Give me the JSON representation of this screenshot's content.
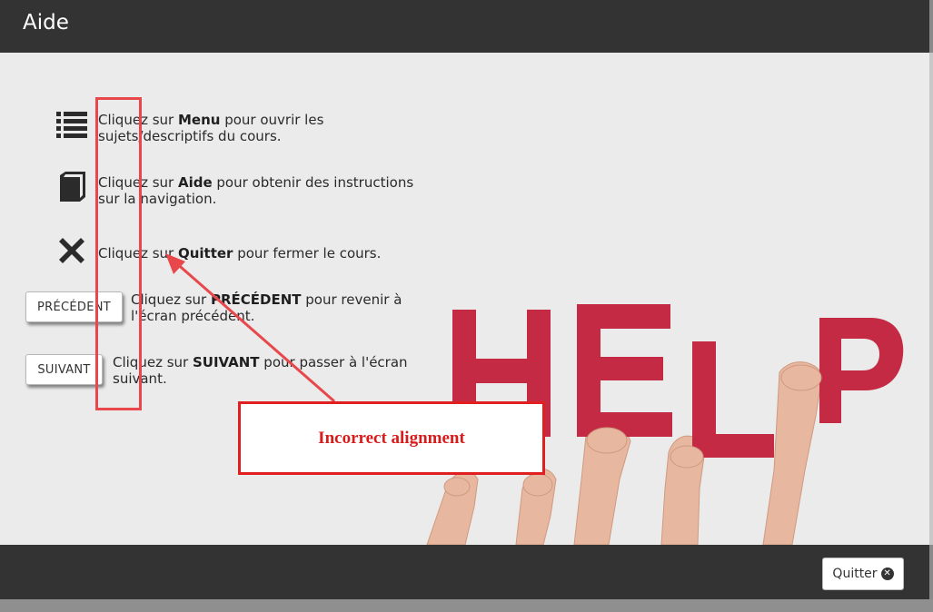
{
  "header": {
    "title": "Aide"
  },
  "help_items": [
    {
      "prefix": "Cliquez sur ",
      "keyword": "Menu",
      "suffix": " pour ouvrir les sujets/descriptifs du cours.",
      "icon": "list-icon"
    },
    {
      "prefix": "Cliquez sur ",
      "keyword": "Aide",
      "suffix": " pour obtenir des instructions sur la navigation.",
      "icon": "book-icon"
    },
    {
      "prefix": "Cliquez sur ",
      "keyword": "Quitter",
      "suffix": " pour fermer le cours.",
      "icon": "close-icon"
    },
    {
      "button_label": "PRÉCÉDENT",
      "prefix": "Cliquez sur ",
      "keyword": "PRÉCÉDENT",
      "suffix": " pour revenir à l'écran précédent."
    },
    {
      "button_label": "SUIVANT",
      "prefix": "Cliquez sur ",
      "keyword": "SUIVANT",
      "suffix": " pour passer à l'écran suivant."
    }
  ],
  "annotation": {
    "label": "Incorrect alignment",
    "color": "#d81c1c"
  },
  "image": {
    "letters": [
      "H",
      "E",
      "L",
      "P"
    ],
    "color": "#c42a44"
  },
  "footer": {
    "quit_label": "Quitter",
    "quit_icon": "close-circle-icon"
  }
}
